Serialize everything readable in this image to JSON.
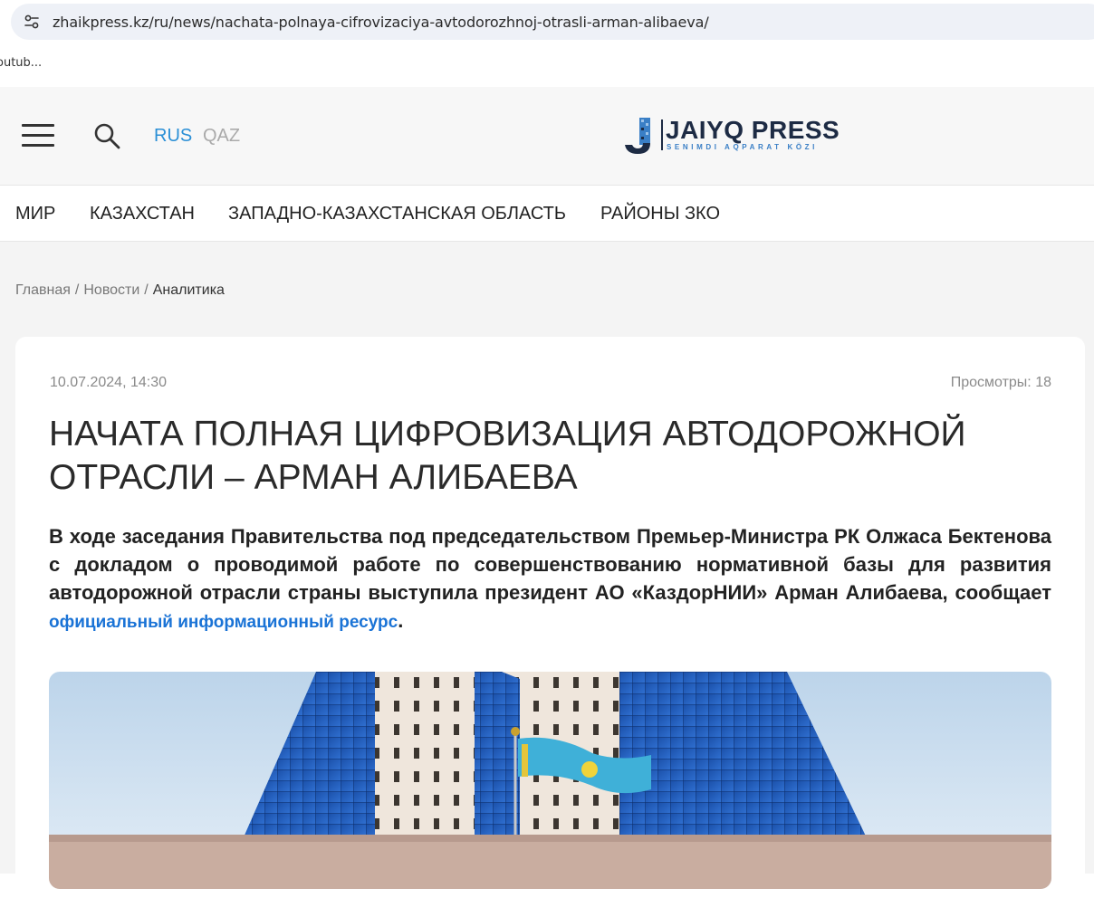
{
  "browser": {
    "url": "zhaikpress.kz/ru/news/nachata-polnaya-cifrovizaciya-avtodorozhnoj-otrasli-arman-alibaeva/",
    "bookmark": "outub..."
  },
  "header": {
    "lang_active": "RUS",
    "lang_other": "QAZ",
    "logo_title": "JAIYQ PRESS",
    "logo_subtitle": "SENIMDI AQPARAT KÖZI"
  },
  "nav": {
    "items": [
      "МИР",
      "КАЗАХСТАН",
      "ЗАПАДНО-КАЗАХСТАНСКАЯ ОБЛАСТЬ",
      "РАЙОНЫ ЗКО"
    ]
  },
  "breadcrumb": {
    "home": "Главная",
    "news": "Новости",
    "current": "Аналитика",
    "separator": "/"
  },
  "article": {
    "date": "10.07.2024, 14:30",
    "views": "Просмотры: 18",
    "title_line1": "НАЧАТА ПОЛНАЯ ЦИФРОВИЗАЦИЯ АВТОДОРОЖНОЙ",
    "title_line2": "ОТРАСЛИ – АРМАН АЛИБАЕВА",
    "lead_text": "В ходе заседания Правительства под председательством Премьер-Министра РК Олжаса Бектенова с докладом о проводимой работе по совершенствованию нормативной базы для развития автодорожной отрасли страны выступила президент АО «КаздорНИИ» Арман Алибаева, сообщает ",
    "lead_link": "официальный информационный ресурс",
    "lead_end": "."
  },
  "colors": {
    "accent": "#2a8fd6",
    "link": "#1a73d6",
    "logo_dark": "#1d2b44"
  }
}
